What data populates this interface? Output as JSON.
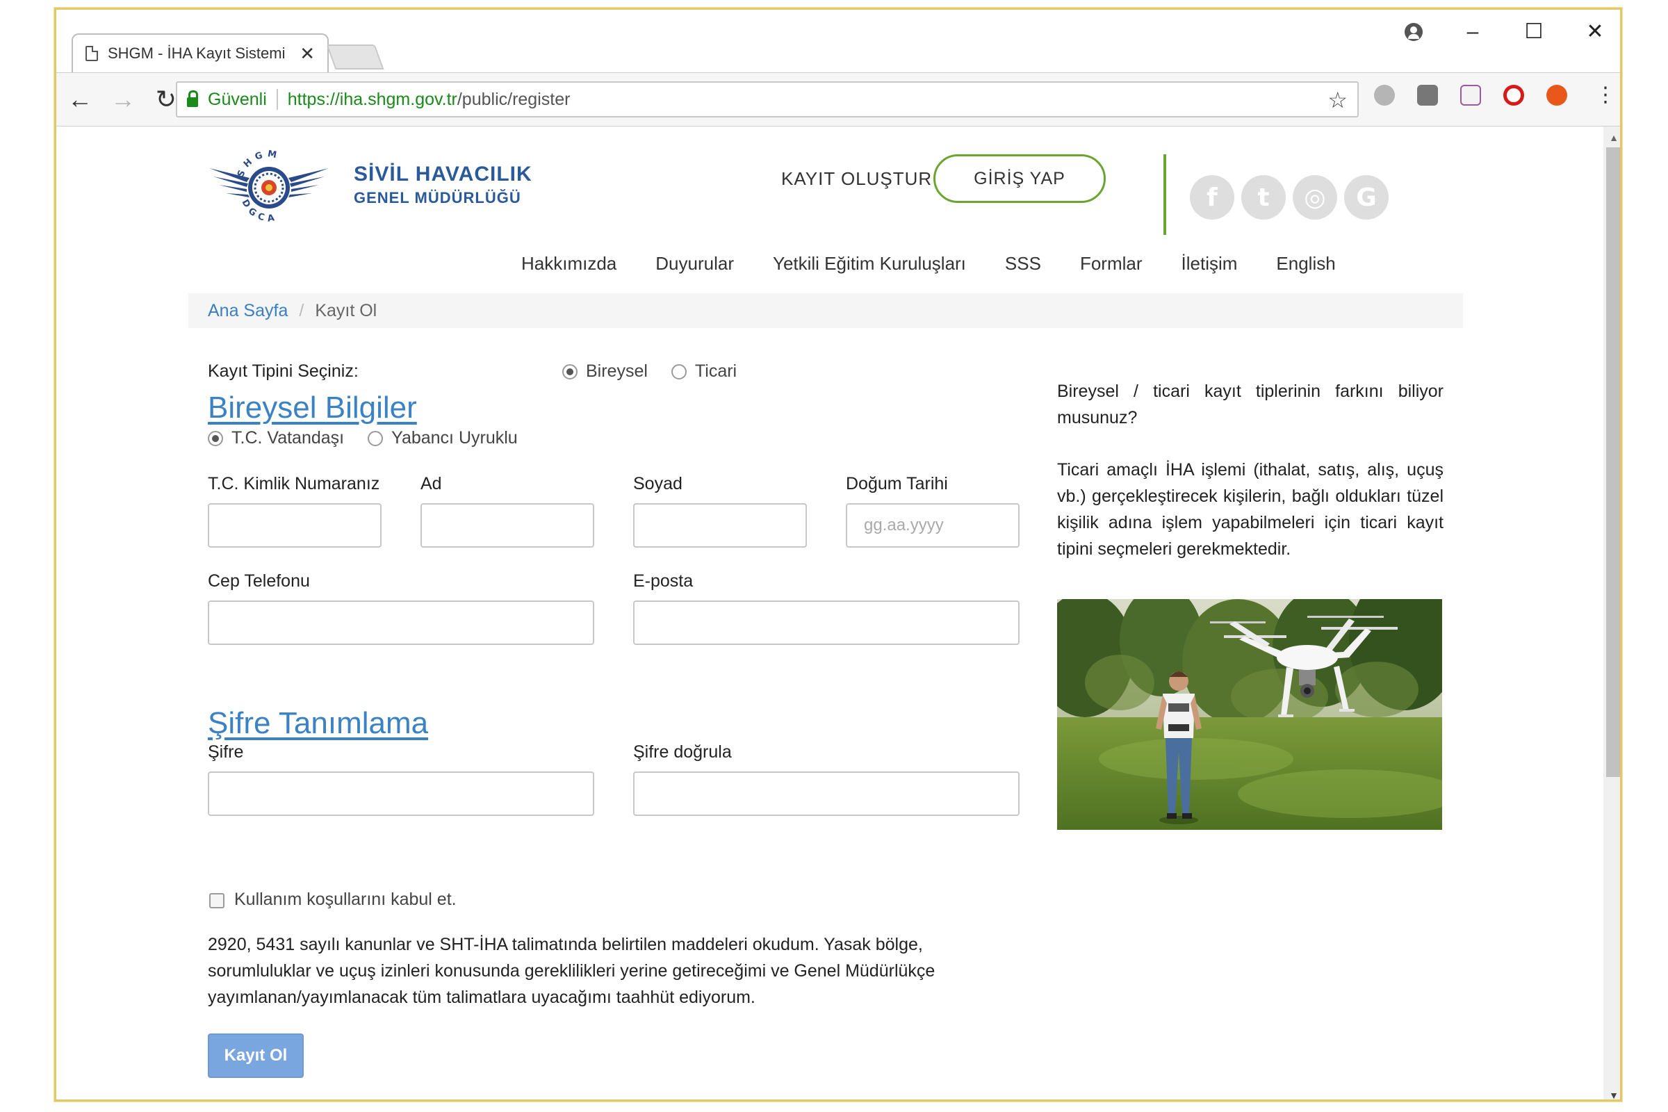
{
  "browser": {
    "tab_title": "SHGM - İHA Kayıt Sistemi",
    "tab_close": "✕",
    "secure_label": "Güvenli",
    "url_main": "https://iha.shgm.gov.tr",
    "url_rest": "/public/register",
    "minimize": "–",
    "maximize": "☐",
    "close": "✕",
    "back": "←",
    "forward": "→",
    "reload": "↻",
    "star": "☆",
    "menu": "⋮"
  },
  "header": {
    "logo_top_letters": "SHGM",
    "logo_bottom_letters": "DGCA",
    "brand_name": "SİVİL HAVACILIK",
    "brand_sub": "GENEL MÜDÜRLÜĞÜ",
    "register_link": "KAYIT OLUŞTUR",
    "login_button": "GİRİŞ YAP",
    "socials": [
      {
        "name": "facebook-icon",
        "glyph": "f"
      },
      {
        "name": "twitter-icon",
        "glyph": "t"
      },
      {
        "name": "instagram-icon",
        "glyph": "◎"
      },
      {
        "name": "google-icon",
        "glyph": "G"
      }
    ],
    "accent_color": "#6aa530",
    "brand_color": "#2a5a9a"
  },
  "nav": {
    "items": [
      "Hakkımızda",
      "Duyurular",
      "Yetkili Eğitim Kuruluşları",
      "SSS",
      "Formlar",
      "İletişim",
      "English"
    ]
  },
  "breadcrumb": {
    "home": "Ana Sayfa",
    "separator": "/",
    "current": "Kayıt Ol"
  },
  "form": {
    "reg_type_label": "Kayıt Tipini Seçiniz:",
    "reg_types": [
      {
        "label": "Bireysel",
        "checked": true
      },
      {
        "label": "Ticari",
        "checked": false
      }
    ],
    "personal_title": "Bireysel Bilgiler",
    "nationality": [
      {
        "label": "T.C. Vatandaşı",
        "checked": true
      },
      {
        "label": "Yabancı Uyruklu",
        "checked": false
      }
    ],
    "tc_label": "T.C. Kimlik Numaranız",
    "tc_value": "",
    "name_label": "Ad",
    "name_value": "",
    "surname_label": "Soyad",
    "surname_value": "",
    "birth_label": "Doğum Tarihi",
    "birth_placeholder": "gg.aa.yyyy",
    "phone_label": "Cep Telefonu",
    "phone_value": "",
    "email_label": "E-posta",
    "email_value": "",
    "password_title": "Şifre Tanımlama",
    "password_label": "Şifre",
    "password_confirm_label": "Şifre doğrula",
    "terms_label": "Kullanım koşullarını kabul et.",
    "terms_checked": false,
    "terms_text": "2920, 5431 sayılı kanunlar ve SHT-İHA talimatında belirtilen maddeleri okudum. Yasak bölge, sorumluluklar ve uçuş izinleri konusunda gereklilikleri yerine getireceğimi ve Genel Müdürlükçe yayımlanan/yayımlanacak tüm talimatlara uyacağımı taahhüt ediyorum.",
    "submit": "Kayıt Ol",
    "link_color": "#3b82c4"
  },
  "info": {
    "question": "Bireysel / ticari kayıt tiplerinin farkını biliyor musunuz?",
    "answer": "Ticari amaçlı İHA işlemi (ithalat, satış, alış, uçuş vb.) gerçekleştirecek kişilerin, bağlı oldukları tüzel kişilik adına işlem yapabilmeleri için ticari kayıt tipini seçmeleri gerekmektedir."
  }
}
